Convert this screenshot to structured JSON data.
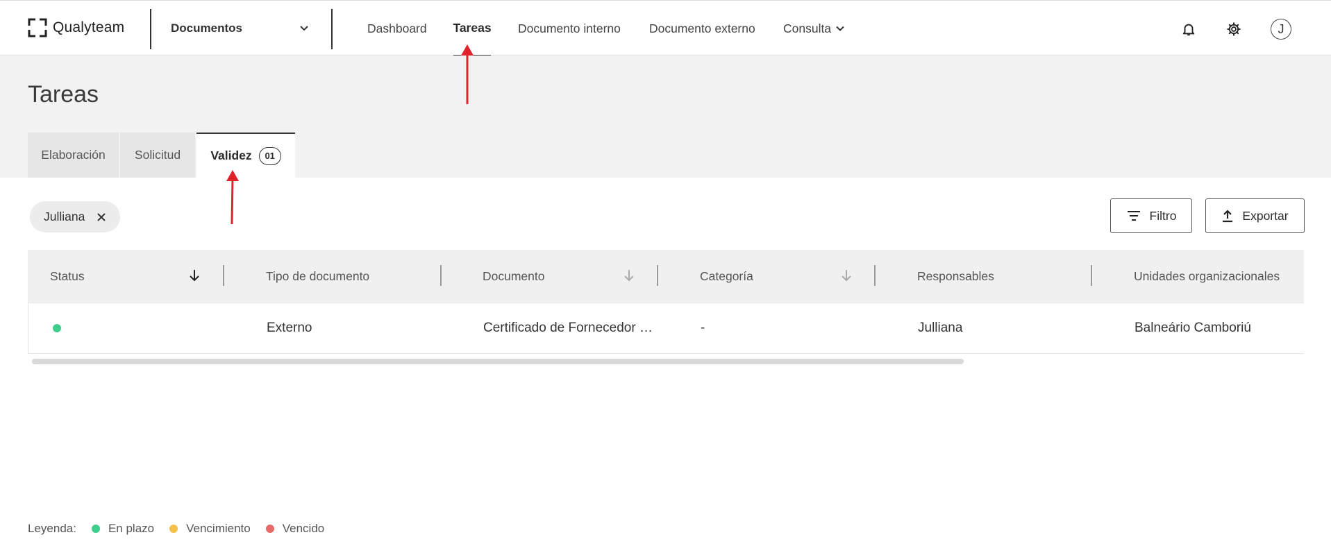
{
  "app": {
    "brand": "Qualyteam",
    "module": "Documentos"
  },
  "nav": {
    "dashboard": "Dashboard",
    "tareas": "Tareas",
    "interno": "Documento interno",
    "externo": "Documento externo",
    "consulta": "Consulta"
  },
  "user": {
    "initial": "J"
  },
  "page": {
    "title": "Tareas"
  },
  "tabs": {
    "elaboracion": "Elaboración",
    "solicitud": "Solicitud",
    "validez": "Validez",
    "validez_count": "01"
  },
  "filter_chip": {
    "label": "Julliana"
  },
  "buttons": {
    "filter": "Filtro",
    "export": "Exportar"
  },
  "table": {
    "headers": {
      "status": "Status",
      "tipo": "Tipo de documento",
      "documento": "Documento",
      "categoria": "Categoría",
      "responsables": "Responsables",
      "unidades": "Unidades organizacionales"
    },
    "rows": [
      {
        "status_color": "#3ecf8e",
        "tipo": "Externo",
        "documento": "Certificado de Fornecedor …",
        "categoria": "-",
        "responsables": "Julliana",
        "unidades": "Balneário Camboriú"
      }
    ]
  },
  "legend": {
    "label": "Leyenda:",
    "items": [
      {
        "label": "En plazo",
        "color": "#3ecf8e"
      },
      {
        "label": "Vencimiento",
        "color": "#f5c04a"
      },
      {
        "label": "Vencido",
        "color": "#e56a6a"
      }
    ]
  },
  "colors": {
    "annotation_arrow": "#e0232b"
  }
}
